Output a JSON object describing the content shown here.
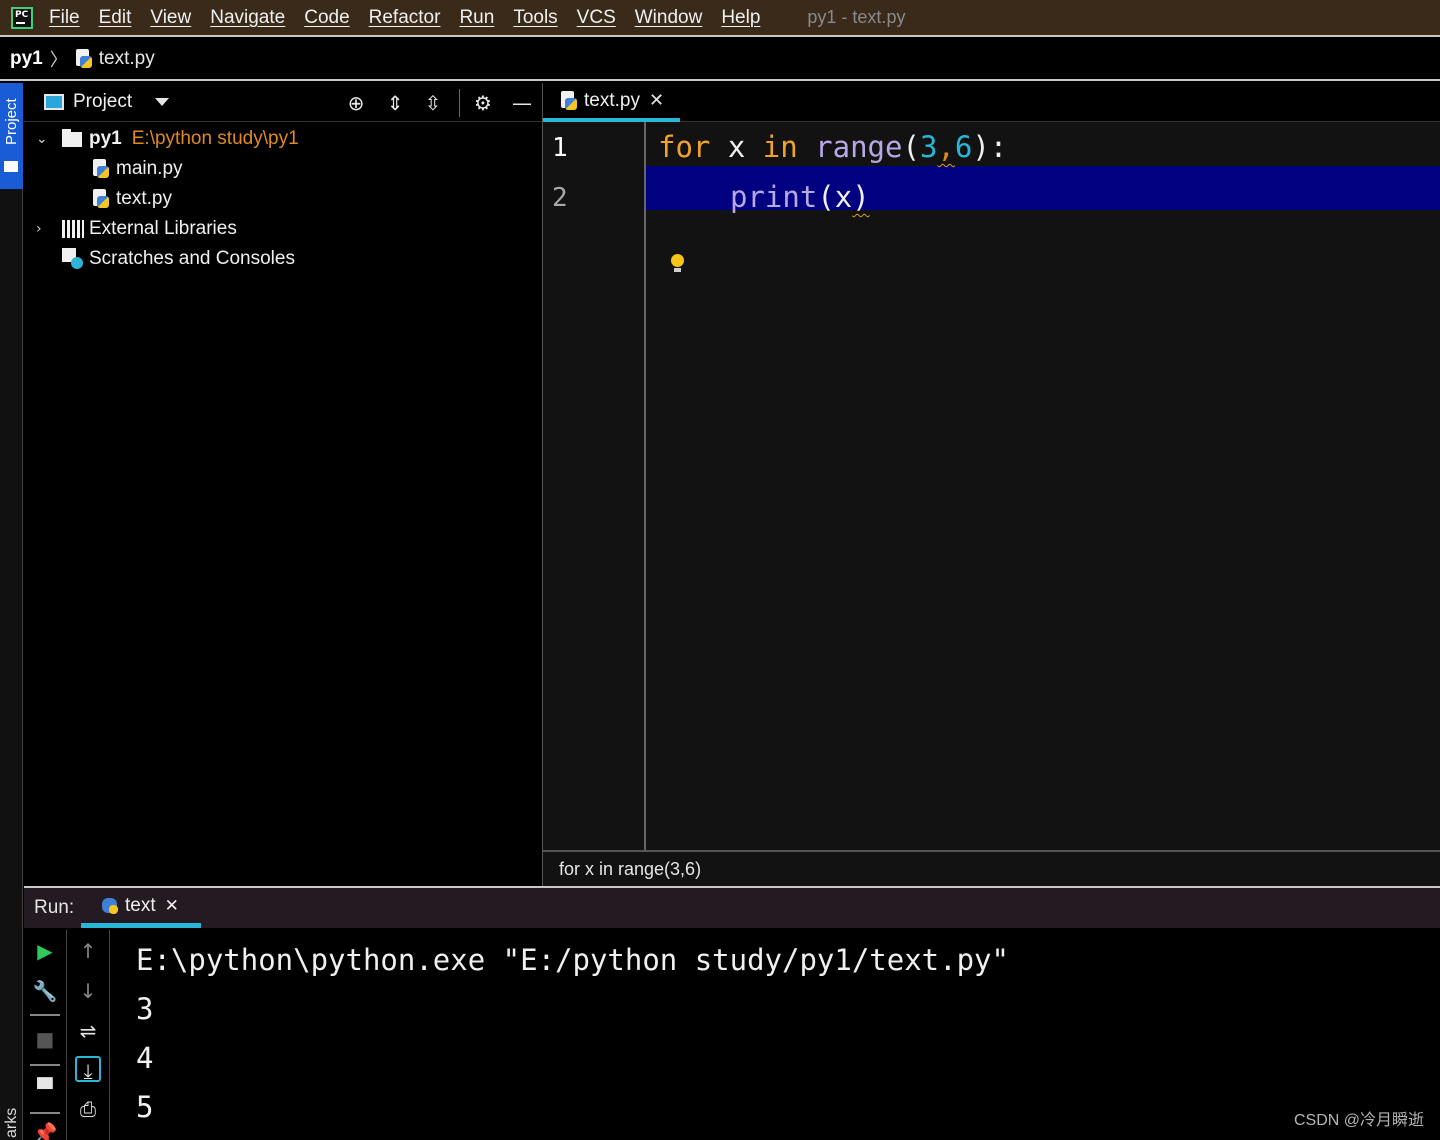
{
  "menubar": {
    "items": [
      "File",
      "Edit",
      "View",
      "Navigate",
      "Code",
      "Refactor",
      "Run",
      "Tools",
      "VCS",
      "Window",
      "Help"
    ],
    "window_title": "py1 - text.py"
  },
  "breadcrumb": {
    "root": "py1",
    "file": "text.py"
  },
  "left_strip": {
    "project_tab": "Project",
    "bookmarks_tab": "arks"
  },
  "project_panel": {
    "view_label": "Project",
    "tree": {
      "root_name": "py1",
      "root_path": "E:\\python study\\py1",
      "files": [
        "main.py",
        "text.py"
      ],
      "external_libraries": "External Libraries",
      "scratches": "Scratches and Consoles"
    }
  },
  "editor": {
    "tab_label": "text.py",
    "line_numbers": [
      "1",
      "2"
    ],
    "code": {
      "line1": {
        "kw_for": "for",
        "var": " x ",
        "kw_in": "in",
        "fn_range": " range",
        "open": "(",
        "n1": "3",
        "comma": ",",
        "n2": "6",
        "close": "):"
      },
      "line2": {
        "fn_print": "print",
        "args_open": "(x",
        "args_close": ")"
      }
    },
    "status": "for x in range(3,6)"
  },
  "run_panel": {
    "label": "Run:",
    "tab_label": "text",
    "console_lines": [
      "E:\\python\\python.exe \"E:/python study/py1/text.py\"",
      "3",
      "4",
      "5"
    ]
  },
  "watermark": "CSDN @冷月瞬逝",
  "colors": {
    "accent": "#2ab6d8",
    "selection": "#000080",
    "keyword": "#f0a22a",
    "function": "#b7a7e6",
    "number": "#2ab6d8",
    "path": "#e08a1e"
  }
}
